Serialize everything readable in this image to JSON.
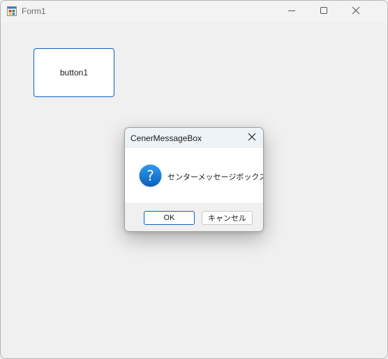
{
  "window": {
    "title": "Form1",
    "icons": {
      "app": "form-app-icon",
      "minimize": "minimize-icon",
      "maximize": "maximize-icon",
      "close": "close-icon"
    }
  },
  "form": {
    "button1_label": "button1"
  },
  "dialog": {
    "title": "CenerMessageBox",
    "message": "センターメッセージボックス",
    "icon": "question-icon",
    "ok_label": "OK",
    "cancel_label": "キャンセル"
  },
  "colors": {
    "accent": "#0a64c2",
    "question_icon": "#1a78d0",
    "dialog_titlebar": "#eef3f7",
    "window_bg": "#f0f0f0"
  }
}
